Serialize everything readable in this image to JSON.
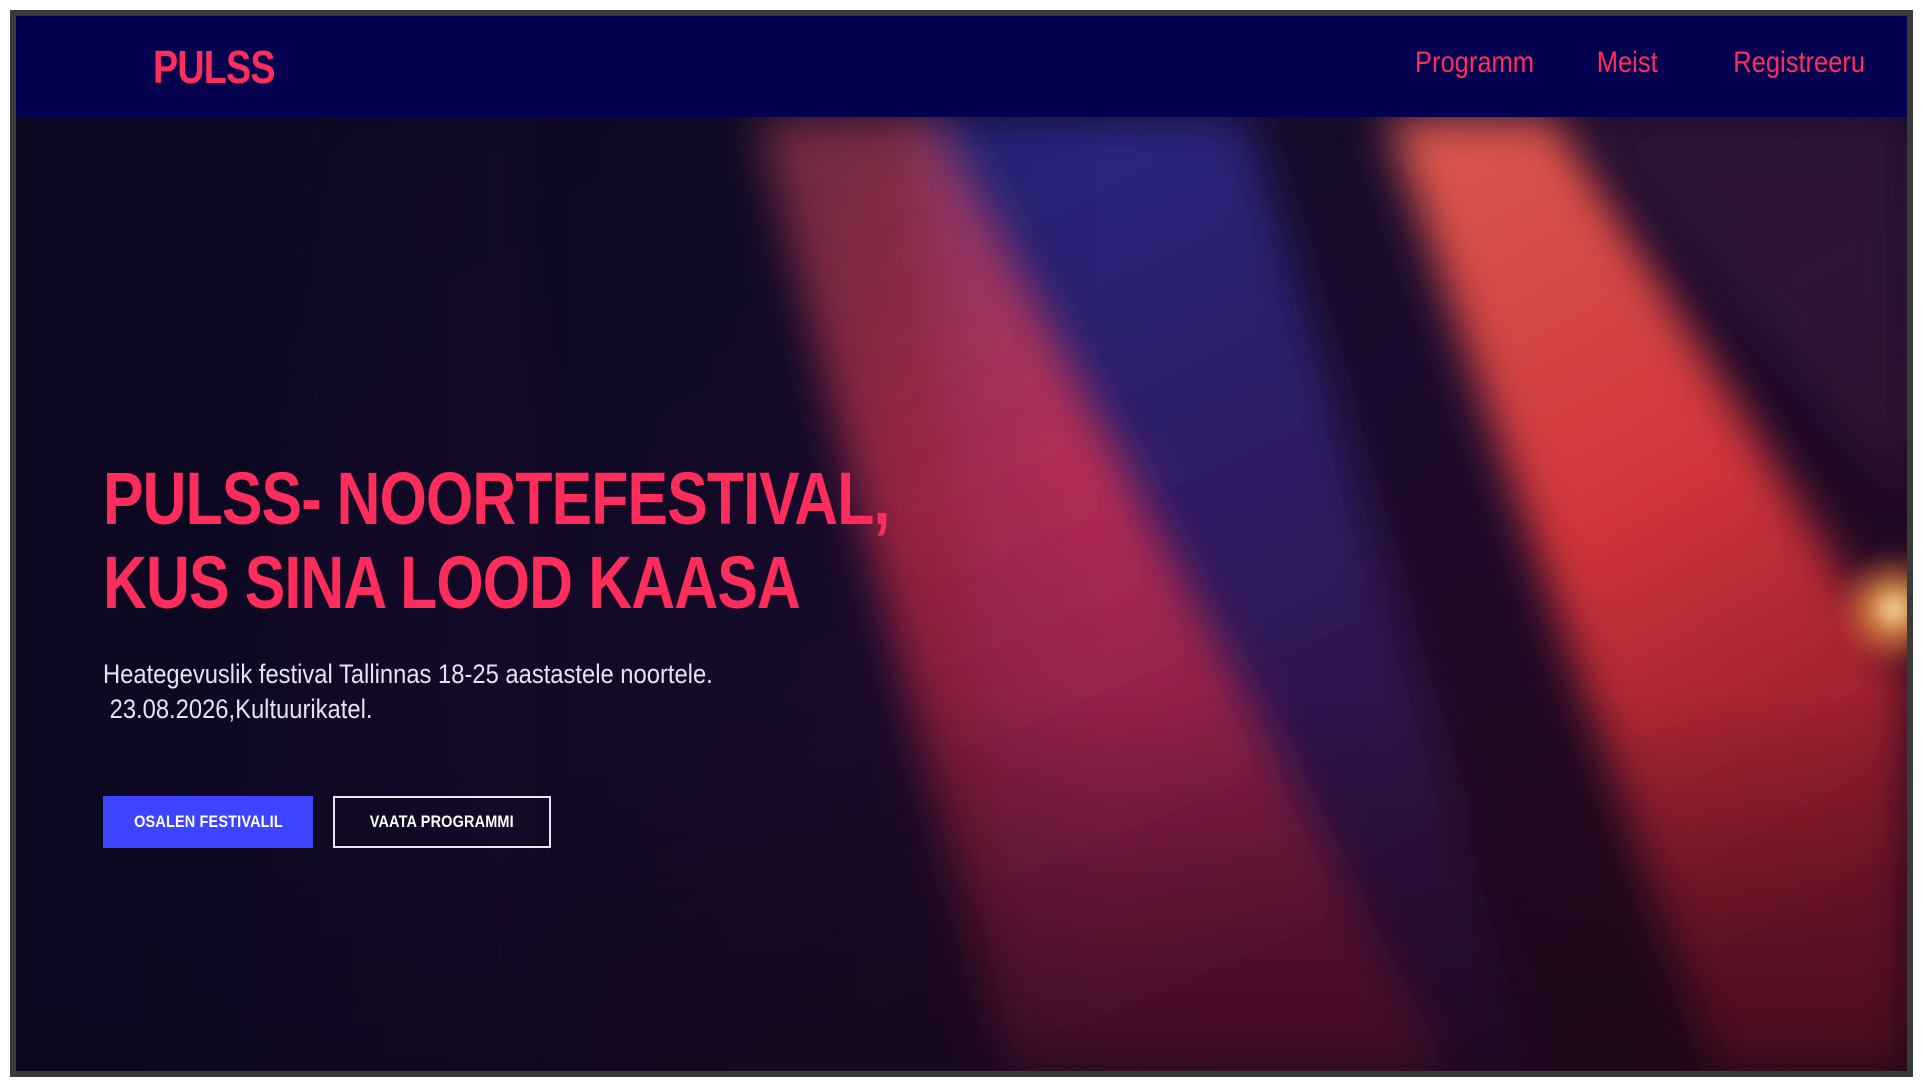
{
  "header": {
    "logo": "PULSS",
    "nav": [
      {
        "label": "Programm"
      },
      {
        "label": "Meist"
      },
      {
        "label": "Registreeru"
      }
    ]
  },
  "hero": {
    "title": "PULSS- NOORTEFESTIVAL, KUS SINA LOOD KAASA",
    "description_line1": "Heategevuslik festival Tallinnas 18-25 aastastele noortele.",
    "description_line2": " 23.08.2026,Kultuurikatel.",
    "primary_button": "Osalen festivalil",
    "secondary_button": "Vaata Programmi"
  },
  "colors": {
    "accent": "#ff2d5c",
    "navbar_bg": "#02004f",
    "primary_button": "#3d44ff"
  }
}
